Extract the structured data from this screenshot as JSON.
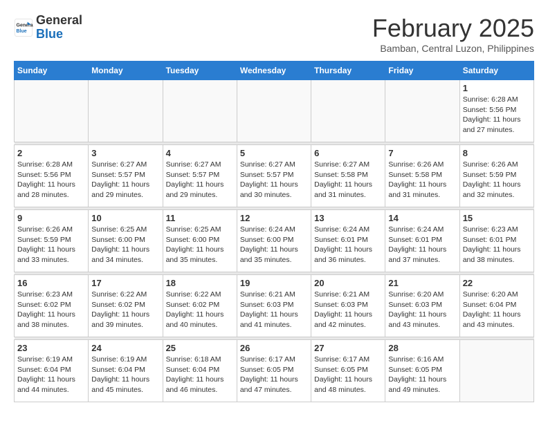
{
  "header": {
    "logo_line1": "General",
    "logo_line2": "Blue",
    "month": "February 2025",
    "location": "Bamban, Central Luzon, Philippines"
  },
  "weekdays": [
    "Sunday",
    "Monday",
    "Tuesday",
    "Wednesday",
    "Thursday",
    "Friday",
    "Saturday"
  ],
  "weeks": [
    [
      {
        "day": "",
        "info": ""
      },
      {
        "day": "",
        "info": ""
      },
      {
        "day": "",
        "info": ""
      },
      {
        "day": "",
        "info": ""
      },
      {
        "day": "",
        "info": ""
      },
      {
        "day": "",
        "info": ""
      },
      {
        "day": "1",
        "info": "Sunrise: 6:28 AM\nSunset: 5:56 PM\nDaylight: 11 hours\nand 27 minutes."
      }
    ],
    [
      {
        "day": "2",
        "info": "Sunrise: 6:28 AM\nSunset: 5:56 PM\nDaylight: 11 hours\nand 28 minutes."
      },
      {
        "day": "3",
        "info": "Sunrise: 6:27 AM\nSunset: 5:57 PM\nDaylight: 11 hours\nand 29 minutes."
      },
      {
        "day": "4",
        "info": "Sunrise: 6:27 AM\nSunset: 5:57 PM\nDaylight: 11 hours\nand 29 minutes."
      },
      {
        "day": "5",
        "info": "Sunrise: 6:27 AM\nSunset: 5:57 PM\nDaylight: 11 hours\nand 30 minutes."
      },
      {
        "day": "6",
        "info": "Sunrise: 6:27 AM\nSunset: 5:58 PM\nDaylight: 11 hours\nand 31 minutes."
      },
      {
        "day": "7",
        "info": "Sunrise: 6:26 AM\nSunset: 5:58 PM\nDaylight: 11 hours\nand 31 minutes."
      },
      {
        "day": "8",
        "info": "Sunrise: 6:26 AM\nSunset: 5:59 PM\nDaylight: 11 hours\nand 32 minutes."
      }
    ],
    [
      {
        "day": "9",
        "info": "Sunrise: 6:26 AM\nSunset: 5:59 PM\nDaylight: 11 hours\nand 33 minutes."
      },
      {
        "day": "10",
        "info": "Sunrise: 6:25 AM\nSunset: 6:00 PM\nDaylight: 11 hours\nand 34 minutes."
      },
      {
        "day": "11",
        "info": "Sunrise: 6:25 AM\nSunset: 6:00 PM\nDaylight: 11 hours\nand 35 minutes."
      },
      {
        "day": "12",
        "info": "Sunrise: 6:24 AM\nSunset: 6:00 PM\nDaylight: 11 hours\nand 35 minutes."
      },
      {
        "day": "13",
        "info": "Sunrise: 6:24 AM\nSunset: 6:01 PM\nDaylight: 11 hours\nand 36 minutes."
      },
      {
        "day": "14",
        "info": "Sunrise: 6:24 AM\nSunset: 6:01 PM\nDaylight: 11 hours\nand 37 minutes."
      },
      {
        "day": "15",
        "info": "Sunrise: 6:23 AM\nSunset: 6:01 PM\nDaylight: 11 hours\nand 38 minutes."
      }
    ],
    [
      {
        "day": "16",
        "info": "Sunrise: 6:23 AM\nSunset: 6:02 PM\nDaylight: 11 hours\nand 38 minutes."
      },
      {
        "day": "17",
        "info": "Sunrise: 6:22 AM\nSunset: 6:02 PM\nDaylight: 11 hours\nand 39 minutes."
      },
      {
        "day": "18",
        "info": "Sunrise: 6:22 AM\nSunset: 6:02 PM\nDaylight: 11 hours\nand 40 minutes."
      },
      {
        "day": "19",
        "info": "Sunrise: 6:21 AM\nSunset: 6:03 PM\nDaylight: 11 hours\nand 41 minutes."
      },
      {
        "day": "20",
        "info": "Sunrise: 6:21 AM\nSunset: 6:03 PM\nDaylight: 11 hours\nand 42 minutes."
      },
      {
        "day": "21",
        "info": "Sunrise: 6:20 AM\nSunset: 6:03 PM\nDaylight: 11 hours\nand 43 minutes."
      },
      {
        "day": "22",
        "info": "Sunrise: 6:20 AM\nSunset: 6:04 PM\nDaylight: 11 hours\nand 43 minutes."
      }
    ],
    [
      {
        "day": "23",
        "info": "Sunrise: 6:19 AM\nSunset: 6:04 PM\nDaylight: 11 hours\nand 44 minutes."
      },
      {
        "day": "24",
        "info": "Sunrise: 6:19 AM\nSunset: 6:04 PM\nDaylight: 11 hours\nand 45 minutes."
      },
      {
        "day": "25",
        "info": "Sunrise: 6:18 AM\nSunset: 6:04 PM\nDaylight: 11 hours\nand 46 minutes."
      },
      {
        "day": "26",
        "info": "Sunrise: 6:17 AM\nSunset: 6:05 PM\nDaylight: 11 hours\nand 47 minutes."
      },
      {
        "day": "27",
        "info": "Sunrise: 6:17 AM\nSunset: 6:05 PM\nDaylight: 11 hours\nand 48 minutes."
      },
      {
        "day": "28",
        "info": "Sunrise: 6:16 AM\nSunset: 6:05 PM\nDaylight: 11 hours\nand 49 minutes."
      },
      {
        "day": "",
        "info": ""
      }
    ]
  ]
}
